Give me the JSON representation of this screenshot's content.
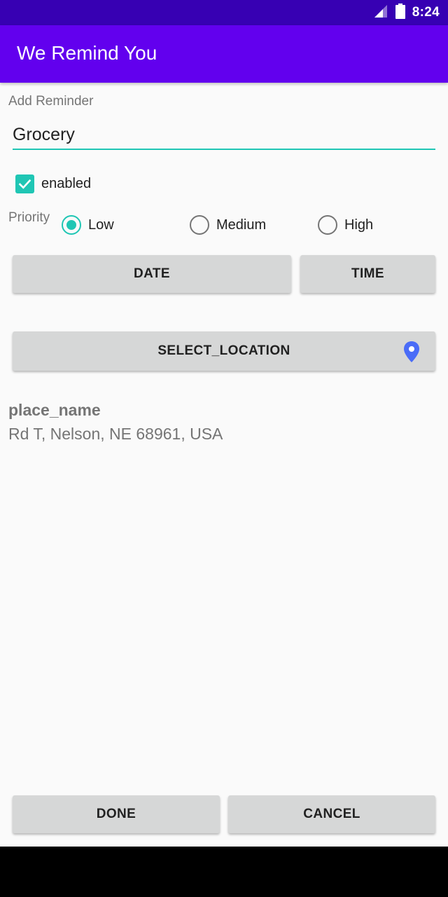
{
  "status_bar": {
    "time": "8:24"
  },
  "app_bar": {
    "title": "We Remind You"
  },
  "form": {
    "label": "Add Reminder",
    "reminder_value": "Grocery",
    "enabled_label": "enabled",
    "enabled_checked": true
  },
  "priority": {
    "label": "Priority",
    "options": [
      {
        "label": "Low",
        "checked": true
      },
      {
        "label": "Medium",
        "checked": false
      },
      {
        "label": "High",
        "checked": false
      }
    ]
  },
  "buttons": {
    "date": "DATE",
    "time": "TIME",
    "select_location": "SELECT_LOCATION",
    "done": "DONE",
    "cancel": "CANCEL"
  },
  "place": {
    "name": "place_name",
    "address": "Rd T, Nelson, NE 68961, USA"
  },
  "colors": {
    "status_bar": "#3700b3",
    "app_bar": "#6200ee",
    "accent": "#1fc6b4",
    "pin": "#4a6cf7",
    "button": "#d6d7d7"
  },
  "icons": [
    "signal-icon",
    "battery-icon",
    "checkmark-icon",
    "location-pin-icon"
  ]
}
